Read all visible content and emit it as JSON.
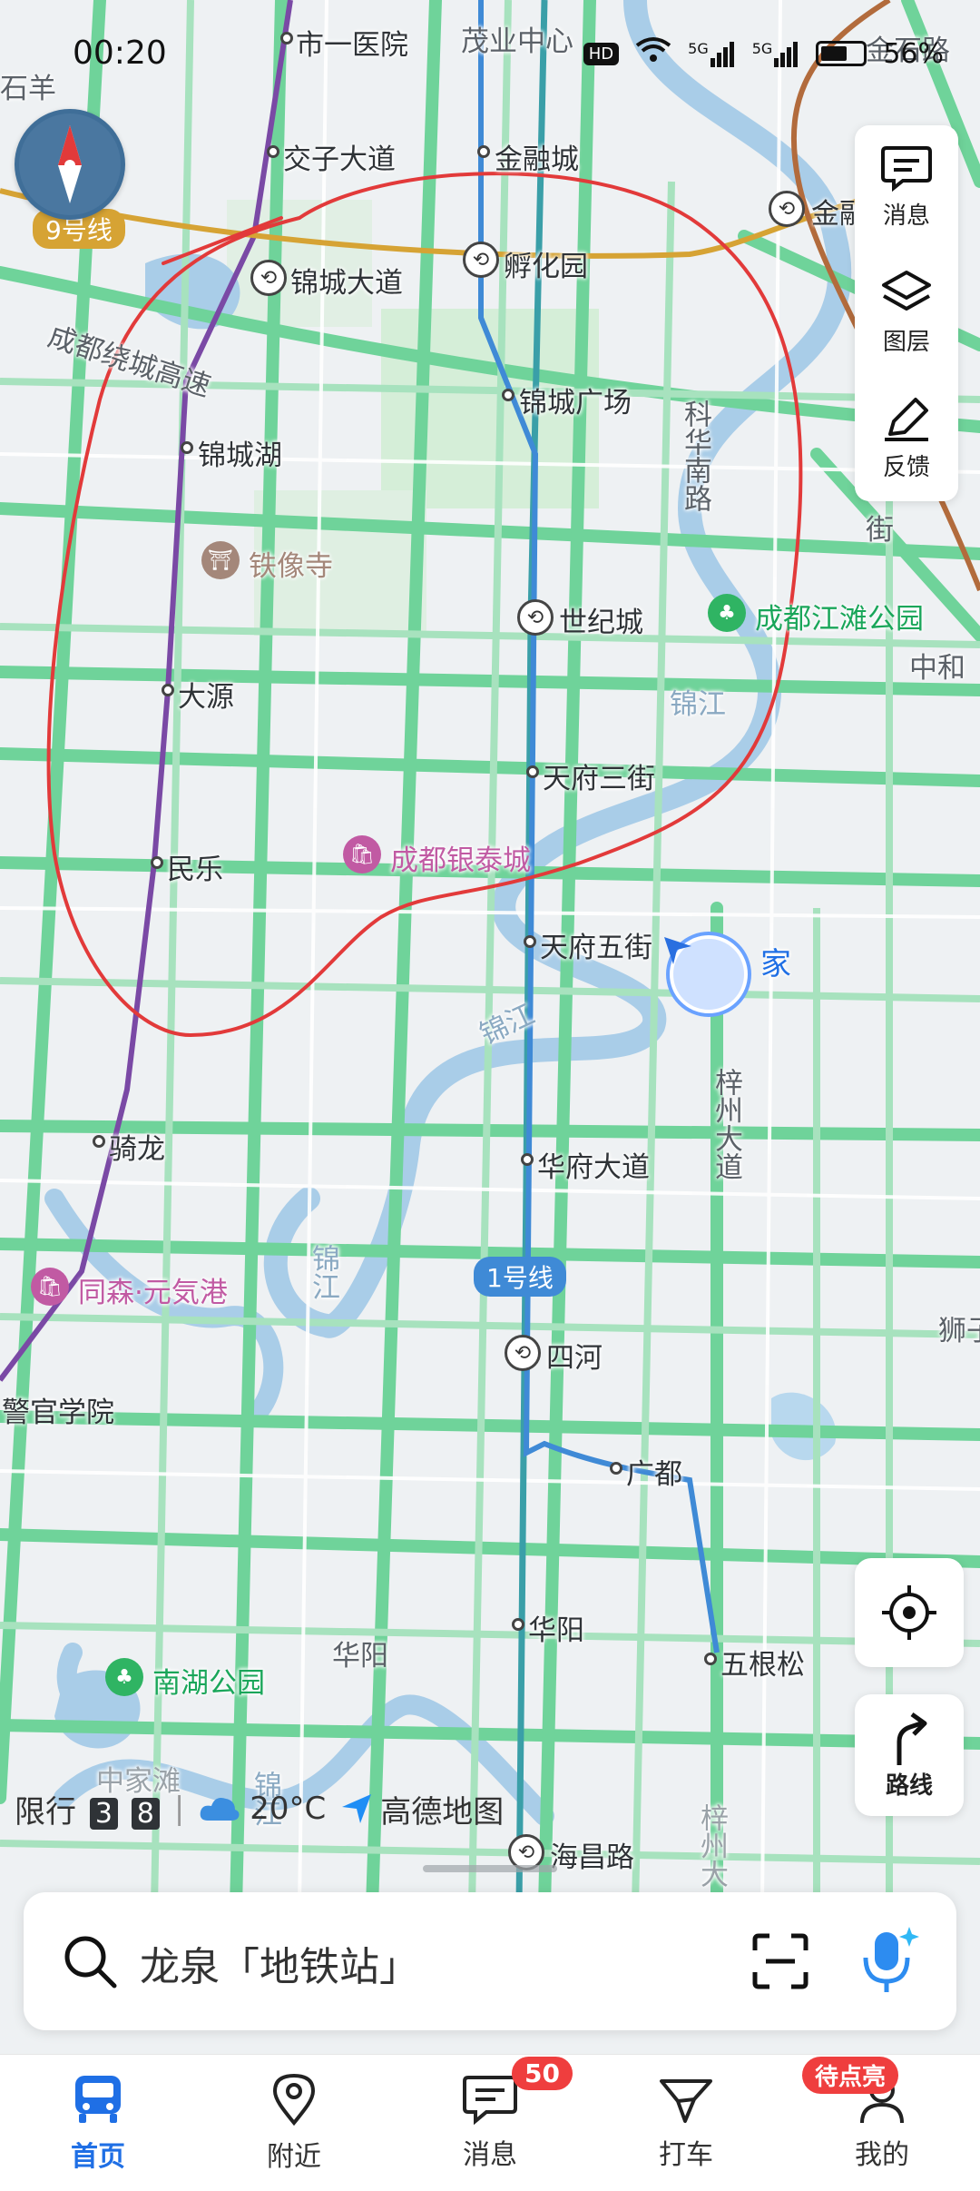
{
  "status_bar": {
    "time": "00:20",
    "hd": "HD",
    "net1": "5G",
    "net2": "5G",
    "battery": "56%"
  },
  "map": {
    "metro_lines": [
      {
        "name": "9号线",
        "color": "#d6a334"
      },
      {
        "name": "1号线",
        "color": "#3f8ad6"
      }
    ],
    "stations": [
      {
        "key": "shiyiyiyuan",
        "label": "市一医院"
      },
      {
        "key": "jiaozidadao",
        "label": "交子大道"
      },
      {
        "key": "jinrongcheng",
        "label": "金融城"
      },
      {
        "key": "jinchengdadao",
        "label": "锦城大道"
      },
      {
        "key": "fuhuayuan",
        "label": "孵化园"
      },
      {
        "key": "jinchengguangchang",
        "label": "锦城广场"
      },
      {
        "key": "jinchenghu",
        "label": "锦城湖"
      },
      {
        "key": "shijicheng",
        "label": "世纪城"
      },
      {
        "key": "dayuan",
        "label": "大源"
      },
      {
        "key": "tianfusanjie",
        "label": "天府三街"
      },
      {
        "key": "minle",
        "label": "民乐"
      },
      {
        "key": "tianfuwujie",
        "label": "天府五街"
      },
      {
        "key": "qilong",
        "label": "骑龙"
      },
      {
        "key": "huafudadao",
        "label": "华府大道"
      },
      {
        "key": "sihe",
        "label": "四河"
      },
      {
        "key": "guangdu",
        "label": "广都"
      },
      {
        "key": "huayang",
        "label": "华阳"
      },
      {
        "key": "wugensong",
        "label": "五根松"
      },
      {
        "key": "haichanglu",
        "label": "海昌路"
      },
      {
        "key": "jinrong_partial",
        "label": "金融"
      }
    ],
    "places": [
      {
        "key": "maoye",
        "label": "茂业中心"
      },
      {
        "key": "shiyang",
        "label": "石羊"
      },
      {
        "key": "tiexiangsi",
        "label": "铁像寺"
      },
      {
        "key": "jiangtan",
        "label": "成都江滩公园"
      },
      {
        "key": "zhonghe",
        "label": "中和"
      },
      {
        "key": "yintai",
        "label": "成都银泰城"
      },
      {
        "key": "tongsen",
        "label": "同森·元気港"
      },
      {
        "key": "jingguan",
        "label": "警官学院"
      },
      {
        "key": "nanhu",
        "label": "南湖公园"
      },
      {
        "key": "huayang_area",
        "label": "华阳"
      },
      {
        "key": "zhongjiatan",
        "label": "中家滩"
      },
      {
        "key": "jinshilu",
        "label": "金石路"
      },
      {
        "key": "shi",
        "label": "狮子"
      }
    ],
    "roads": [
      {
        "key": "raocheng",
        "label": "成都绕城高速"
      },
      {
        "key": "kehua",
        "label": "科华南路"
      },
      {
        "key": "zizhou1",
        "label": "梓州大道"
      },
      {
        "key": "zizhou2",
        "label": "梓州大"
      },
      {
        "key": "jie",
        "label": "街"
      }
    ],
    "rivers": [
      {
        "key": "jinjiang1",
        "label": "锦江"
      },
      {
        "key": "jinjiang2",
        "label": "锦江"
      },
      {
        "key": "jinjiang3",
        "label": "锦江"
      },
      {
        "key": "jinjiang4",
        "label": "锦江"
      }
    ],
    "home_label": "家"
  },
  "right_panel": {
    "messages": "消息",
    "layers": "图层",
    "feedback": "反馈"
  },
  "controls": {
    "route": "路线"
  },
  "info_strip": {
    "restriction": "限行",
    "plate1": "3",
    "plate2": "8",
    "temperature": "20°C",
    "logo_text": "高德地图"
  },
  "search": {
    "placeholder": "龙泉「地铁站」"
  },
  "tabbar": {
    "items": [
      {
        "label": "首页"
      },
      {
        "label": "附近"
      },
      {
        "label": "消息",
        "badge": "50"
      },
      {
        "label": "打车"
      },
      {
        "label": "我的",
        "badge": "待点亮"
      }
    ]
  }
}
